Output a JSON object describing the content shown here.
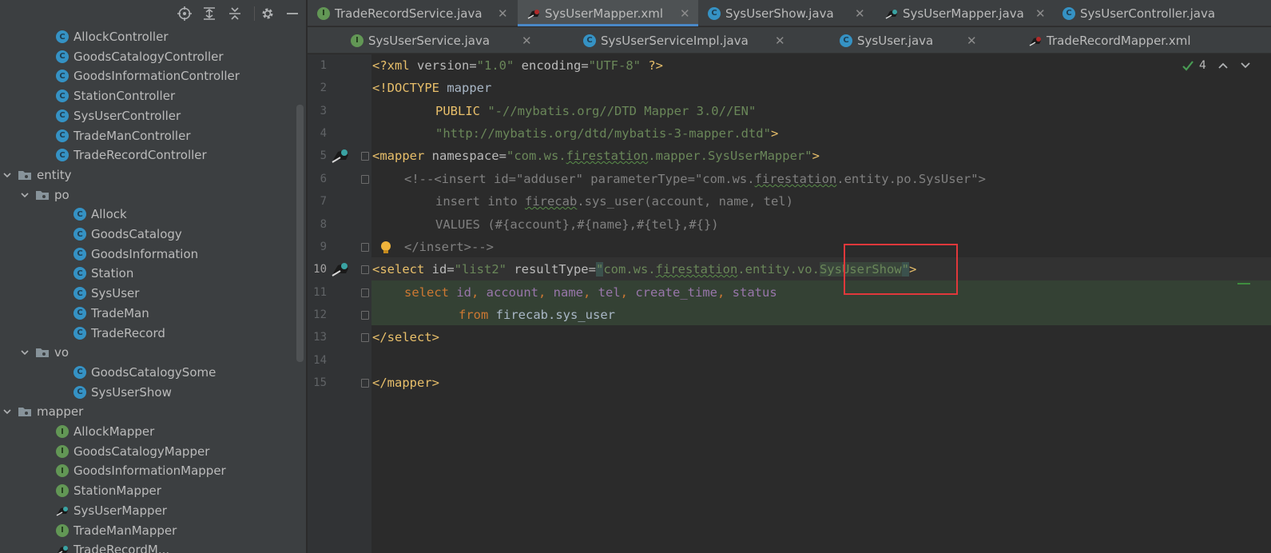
{
  "project_panel": {
    "toolbar_icons": [
      "locate-icon",
      "expand-all-icon",
      "collapse-all-icon",
      "gear-icon",
      "hide-icon"
    ],
    "tree": [
      {
        "label": "AllockController",
        "icon": "class"
      },
      {
        "label": "GoodsCatalogyController",
        "icon": "class"
      },
      {
        "label": "GoodsInformationController",
        "icon": "class"
      },
      {
        "label": "StationController",
        "icon": "class"
      },
      {
        "label": "SysUserController",
        "icon": "class"
      },
      {
        "label": "TradeManController",
        "icon": "class"
      },
      {
        "label": "TradeRecordController",
        "icon": "class"
      },
      {
        "label": "entity",
        "icon": "package"
      },
      {
        "label": "po",
        "icon": "package"
      },
      {
        "label": "Allock",
        "icon": "class"
      },
      {
        "label": "GoodsCatalogy",
        "icon": "class"
      },
      {
        "label": "GoodsInformation",
        "icon": "class"
      },
      {
        "label": "Station",
        "icon": "class"
      },
      {
        "label": "SysUser",
        "icon": "class"
      },
      {
        "label": "TradeMan",
        "icon": "class"
      },
      {
        "label": "TradeRecord",
        "icon": "class"
      },
      {
        "label": "vo",
        "icon": "package"
      },
      {
        "label": "GoodsCatalogySome",
        "icon": "class"
      },
      {
        "label": "SysUserShow",
        "icon": "class"
      },
      {
        "label": "mapper",
        "icon": "package"
      },
      {
        "label": "AllockMapper",
        "icon": "interface"
      },
      {
        "label": "GoodsCatalogyMapper",
        "icon": "interface"
      },
      {
        "label": "GoodsInformationMapper",
        "icon": "interface"
      },
      {
        "label": "StationMapper",
        "icon": "interface"
      },
      {
        "label": "SysUserMapper",
        "icon": "mybatis"
      },
      {
        "label": "TradeManMapper",
        "icon": "interface"
      },
      {
        "label": "TradeRecordM...",
        "icon": "mybatis"
      }
    ]
  },
  "tabs_row1": [
    {
      "label": "TradeRecordService.java",
      "icon": "interface"
    },
    {
      "label": "SysUserMapper.xml",
      "icon": "mybatis-xml",
      "active": true
    },
    {
      "label": "SysUserShow.java",
      "icon": "class"
    },
    {
      "label": "SysUserMapper.java",
      "icon": "mybatis"
    },
    {
      "label": "SysUserController.java",
      "icon": "class"
    }
  ],
  "tabs_row2": [
    {
      "label": "SysUserService.java",
      "icon": "interface"
    },
    {
      "label": "SysUserServiceImpl.java",
      "icon": "class"
    },
    {
      "label": "SysUser.java",
      "icon": "class"
    },
    {
      "label": "TradeRecordMapper.xml",
      "icon": "mybatis-xml"
    }
  ],
  "editor": {
    "line_numbers": [
      "1",
      "2",
      "3",
      "4",
      "5",
      "6",
      "7",
      "8",
      "9",
      "10",
      "11",
      "12",
      "13",
      "14",
      "15"
    ],
    "inspection_count": "4",
    "code": {
      "l1_open": "<?xml ",
      "l1_a1": "version=",
      "l1_v1": "\"1.0\"",
      "l1_a2": " encoding=",
      "l1_v2": "\"UTF-8\"",
      "l1_close": " ?>",
      "l2_tag": "<!DOCTYPE ",
      "l2_txt": "mapper",
      "l3_kw": "PUBLIC ",
      "l3_val": "\"-//mybatis.org//DTD Mapper 3.0//EN\"",
      "l4_val": "\"http://mybatis.org/dtd/mybatis-3-mapper.dtd\"",
      "l4_close": ">",
      "l5_tag": "<mapper ",
      "l5_attr": "namespace=",
      "l5_v_a": "\"com.ws.",
      "l5_v_b": "firestation",
      "l5_v_c": ".mapper.SysUserMapper\"",
      "l5_close": ">",
      "l6_a": "<!--<insert id=\"adduser\" parameterType=\"com.ws.",
      "l6_b": "firestation",
      "l6_c": ".entity.po.SysUser\">",
      "l7_a": "insert into ",
      "l7_b": "firecab",
      "l7_c": ".sys_user(account, name, tel)",
      "l8": "VALUES (#{account},#{name},#{tel},#{})",
      "l9": "</insert>-->",
      "l10_tag": "<select ",
      "l10_a1": "id=",
      "l10_v1": "\"list2\"",
      "l10_a2": " resultType=",
      "l10_q1": "\"",
      "l10_v2a": "com.ws.",
      "l10_v2b": "firestation",
      "l10_v2c": ".entity.vo.",
      "l10_cls": "SysUserShow",
      "l10_q2": "\"",
      "l10_close": ">",
      "l11_kw1": "select ",
      "l11_c1": "id",
      "l11_p1": ", ",
      "l11_c2": "account",
      "l11_p2": ", ",
      "l11_c3": "name",
      "l11_p3": ", ",
      "l11_c4": "tel",
      "l11_p4": ", ",
      "l11_c5": "create_time",
      "l11_p5": ", ",
      "l11_c6": "status",
      "l12_kw": "from ",
      "l12_txt": "firecab.sys_user",
      "l13": "</select>",
      "l15": "</mapper>"
    }
  },
  "colors": {
    "tag": "#e8bf6a",
    "attribute_value": "#6a8759",
    "comment": "#808080",
    "sql_keyword": "#cc7832",
    "sql_column": "#9876aa",
    "highlight_box": "#e0383b"
  }
}
